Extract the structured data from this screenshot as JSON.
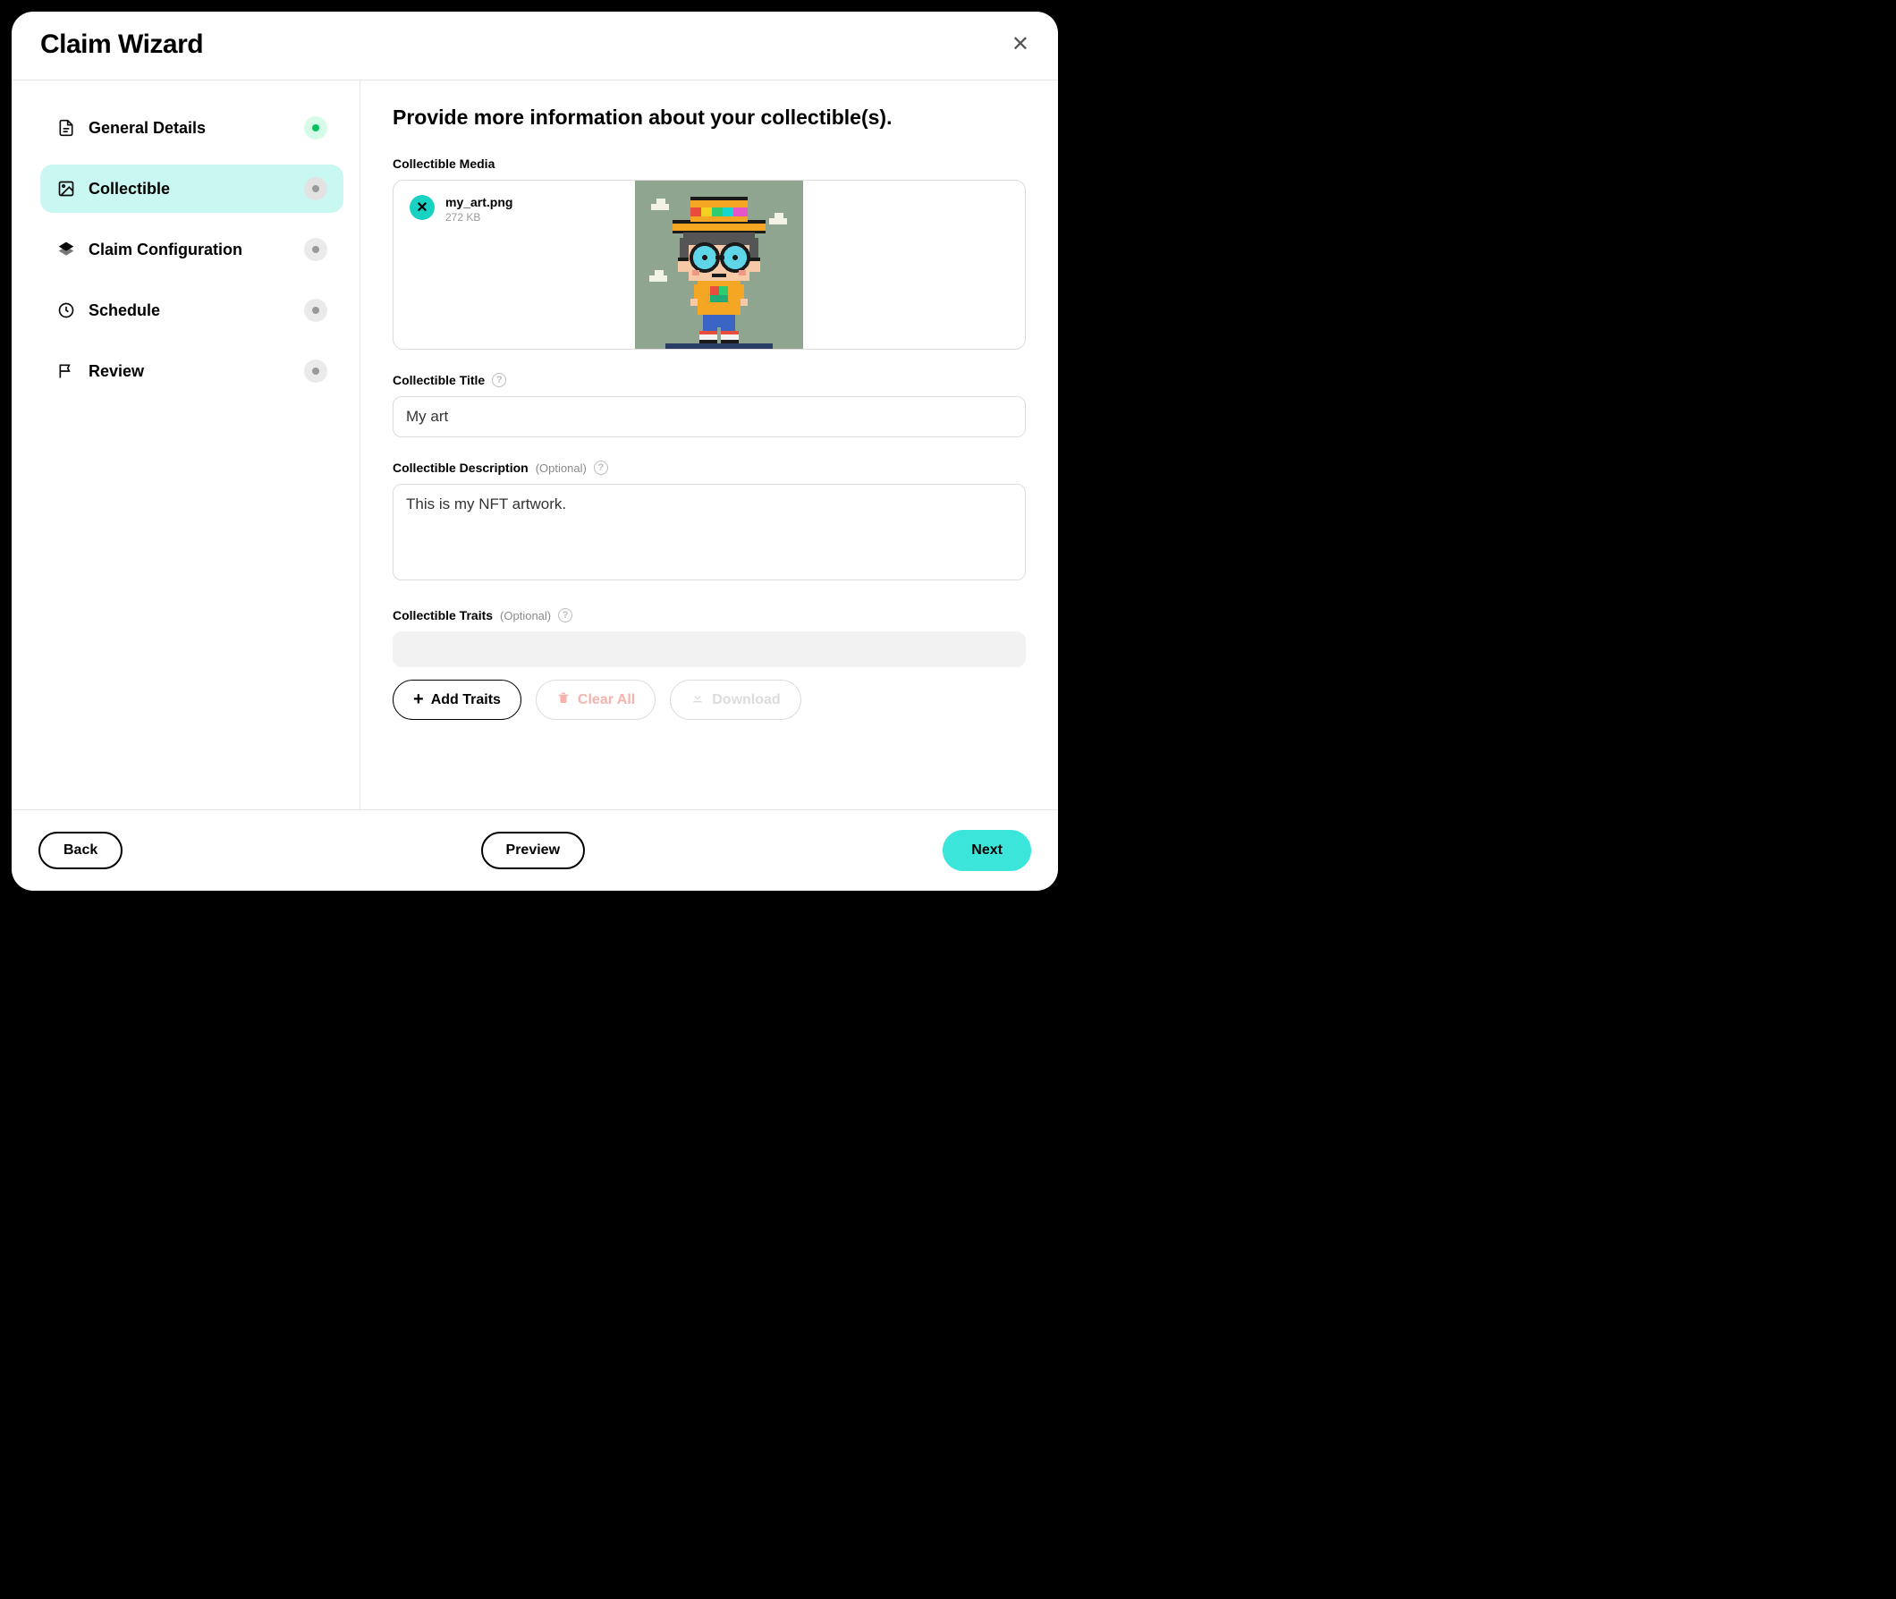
{
  "header": {
    "title": "Claim Wizard"
  },
  "steps": [
    {
      "label": "General Details",
      "status": "done"
    },
    {
      "label": "Collectible",
      "status": "current"
    },
    {
      "label": "Claim Configuration",
      "status": "pending"
    },
    {
      "label": "Schedule",
      "status": "pending"
    },
    {
      "label": "Review",
      "status": "pending"
    }
  ],
  "content": {
    "heading": "Provide more information about your collectible(s).",
    "media_label": "Collectible Media",
    "file": {
      "name": "my_art.png",
      "size": "272 KB"
    },
    "title_label": "Collectible Title",
    "title_value": "My art",
    "desc_label": "Collectible Description",
    "desc_optional": "(Optional)",
    "desc_value": "This is my NFT artwork.",
    "traits_label": "Collectible Traits",
    "traits_optional": "(Optional)"
  },
  "buttons": {
    "add_traits": "Add Traits",
    "clear_all": "Clear All",
    "download": "Download",
    "back": "Back",
    "preview": "Preview",
    "next": "Next"
  }
}
